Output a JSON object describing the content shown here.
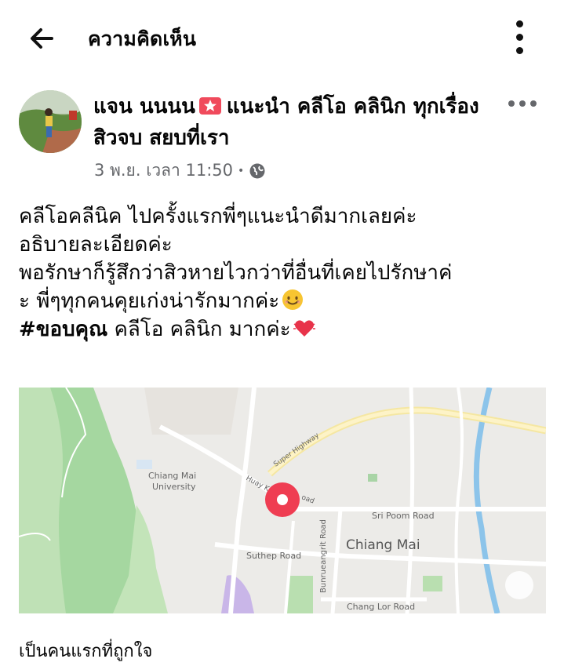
{
  "header": {
    "title": "ความคิดเห็น"
  },
  "post": {
    "author_name": "แจน นนนน",
    "author_rest": "แนะนำ คลีโอ คลินิก ทุกเรื่องสิวจบ สยบที่เรา",
    "timestamp": "3 พ.ย. เวลา 11:50",
    "separator": "•",
    "body_lines": [
      "คลีโอคลีนิค ไปครั้งแรกพี่ๆแนะนำดีมากเลยค่ะ",
      "อธิบายละเอียดค่ะ",
      "พอรักษาก็รู้สึกว่าสิวหายไวกว่าที่อื่นที่เคยไปรักษาค่",
      "ะ พี่ๆทุกคนคุยเก่งน่ารักมากค่ะ"
    ],
    "hashtag": "#ขอบคุณ",
    "last_line": " คลีโอ คลินิก มากค่ะ",
    "map": {
      "city": "Chiang Mai",
      "university_line1": "Chiang Mai",
      "university_line2": "University",
      "roads": {
        "super_highway": "Super Highway",
        "huay_kaew": "Huay K",
        "huay_kaew_end": "oad",
        "sri_poom": "Sri Poom Road",
        "suthep": "Suthep Road",
        "bunrueangrit": "Bunrueangrit Road",
        "chang_lor": "Chang Lor Road"
      }
    }
  },
  "reactions": {
    "first_like": "เป็นคนแรกที่ถูกใจ"
  },
  "icons": [
    "back-arrow-icon",
    "kebab-menu-icon",
    "star-badge-icon",
    "more-horizontal-icon",
    "globe-icon",
    "smile-emoji-icon",
    "heart-emoji-icon",
    "map-pin-icon",
    "locate-icon"
  ],
  "colors": {
    "pin": "#ef3d52",
    "meta_gray": "#65676b",
    "badge": "#f04a5c"
  }
}
